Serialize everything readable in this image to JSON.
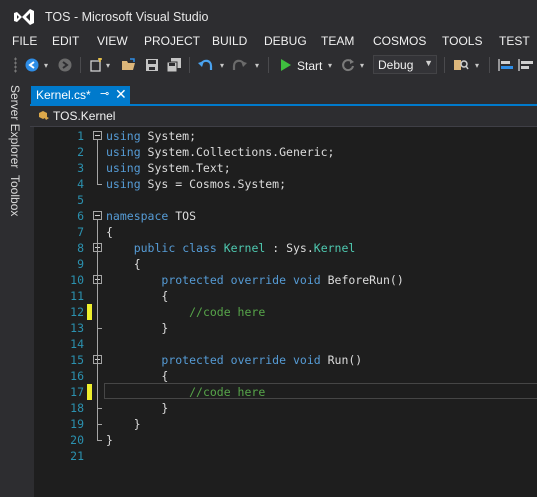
{
  "window": {
    "title": "TOS - Microsoft Visual Studio"
  },
  "menu": [
    {
      "label": "FILE"
    },
    {
      "label": "EDIT"
    },
    {
      "label": "VIEW"
    },
    {
      "label": "PROJECT"
    },
    {
      "label": "BUILD"
    },
    {
      "label": "DEBUG"
    },
    {
      "label": "TEAM"
    },
    {
      "label": "COSMOS"
    },
    {
      "label": "TOOLS"
    },
    {
      "label": "TEST"
    }
  ],
  "toolbar": {
    "start_label": "Start",
    "configuration": "Debug",
    "icons": [
      "back-icon",
      "forward-icon",
      "new-project-icon",
      "open-file-icon",
      "save-icon",
      "save-all-icon",
      "undo-icon",
      "redo-icon",
      "start-play-icon",
      "refresh-icon",
      "find-icon",
      "comment-icon"
    ]
  },
  "side_tabs": [
    "Server Explorer",
    "Toolbox"
  ],
  "document_tab": {
    "label": "Kernel.cs*"
  },
  "navigation": {
    "class_label": "TOS.Kernel"
  },
  "editor": {
    "lines": [
      {
        "n": "1",
        "tokens": [
          [
            "kw",
            "using"
          ],
          [
            "",
            " System;"
          ]
        ]
      },
      {
        "n": "2",
        "tokens": [
          [
            "kw",
            "using"
          ],
          [
            "",
            " System.Collections.Generic;"
          ]
        ]
      },
      {
        "n": "3",
        "tokens": [
          [
            "kw",
            "using"
          ],
          [
            "",
            " System.Text;"
          ]
        ]
      },
      {
        "n": "4",
        "tokens": [
          [
            "kw",
            "using"
          ],
          [
            "",
            " Sys = Cosmos.System;"
          ]
        ]
      },
      {
        "n": "5",
        "tokens": []
      },
      {
        "n": "6",
        "tokens": [
          [
            "kw",
            "namespace"
          ],
          [
            "",
            " TOS"
          ]
        ]
      },
      {
        "n": "7",
        "tokens": [
          [
            "",
            "{"
          ]
        ]
      },
      {
        "n": "8",
        "tokens": [
          [
            "",
            "    "
          ],
          [
            "kw",
            "public"
          ],
          [
            "",
            " "
          ],
          [
            "kw",
            "class"
          ],
          [
            "",
            " "
          ],
          [
            "ty",
            "Kernel"
          ],
          [
            "",
            " : Sys."
          ],
          [
            "ty",
            "Kernel"
          ]
        ]
      },
      {
        "n": "9",
        "tokens": [
          [
            "",
            "    {"
          ]
        ]
      },
      {
        "n": "10",
        "tokens": [
          [
            "",
            "        "
          ],
          [
            "kw",
            "protected"
          ],
          [
            "",
            " "
          ],
          [
            "kw",
            "override"
          ],
          [
            "",
            " "
          ],
          [
            "kw",
            "void"
          ],
          [
            "",
            " BeforeRun()"
          ]
        ]
      },
      {
        "n": "11",
        "tokens": [
          [
            "",
            "        {"
          ]
        ]
      },
      {
        "n": "12",
        "tokens": [
          [
            "",
            "            "
          ],
          [
            "cm",
            "//code here"
          ]
        ]
      },
      {
        "n": "13",
        "tokens": [
          [
            "",
            "        }"
          ]
        ]
      },
      {
        "n": "14",
        "tokens": []
      },
      {
        "n": "15",
        "tokens": [
          [
            "",
            "        "
          ],
          [
            "kw",
            "protected"
          ],
          [
            "",
            " "
          ],
          [
            "kw",
            "override"
          ],
          [
            "",
            " "
          ],
          [
            "kw",
            "void"
          ],
          [
            "",
            " Run()"
          ]
        ]
      },
      {
        "n": "16",
        "tokens": [
          [
            "",
            "        {"
          ]
        ]
      },
      {
        "n": "17",
        "tokens": [
          [
            "",
            "            "
          ],
          [
            "cm",
            "//code here"
          ]
        ]
      },
      {
        "n": "18",
        "tokens": [
          [
            "",
            "        }"
          ]
        ]
      },
      {
        "n": "19",
        "tokens": [
          [
            "",
            "    }"
          ]
        ]
      },
      {
        "n": "20",
        "tokens": [
          [
            "",
            "}"
          ]
        ]
      },
      {
        "n": "21",
        "tokens": []
      }
    ],
    "colors": {
      "keyword": "#569cd6",
      "type": "#4ec9b0",
      "comment": "#57a64a",
      "line_number": "#2b91af",
      "change_marker": "#efef2c"
    }
  }
}
